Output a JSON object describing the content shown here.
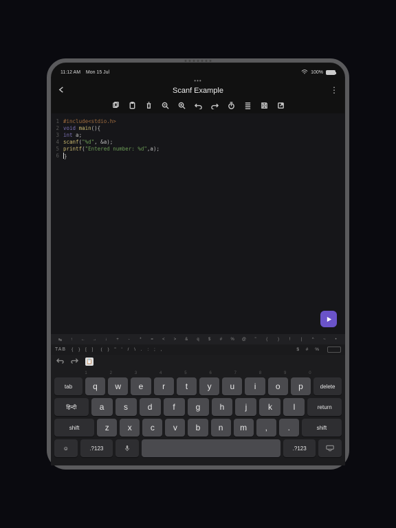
{
  "status": {
    "time": "11:12 AM",
    "date": "Mon 15 Jul",
    "battery": "100%"
  },
  "header": {
    "dots": "•••",
    "title": "Scanf Example"
  },
  "toolbar": {
    "icons": [
      "copy",
      "paste",
      "delete",
      "zoom-out",
      "zoom-in",
      "undo",
      "redo",
      "timer",
      "indent",
      "save",
      "share"
    ]
  },
  "code": {
    "lines": [
      {
        "n": "1",
        "segs": [
          {
            "cls": "tok-preproc",
            "t": "#include<stdio.h>"
          }
        ]
      },
      {
        "n": "2",
        "segs": [
          {
            "cls": "tok-kw",
            "t": "void"
          },
          {
            "cls": "tok-plain",
            "t": " "
          },
          {
            "cls": "tok-fn",
            "t": "main"
          },
          {
            "cls": "tok-plain",
            "t": "(){"
          }
        ]
      },
      {
        "n": "3",
        "segs": [
          {
            "cls": "tok-type",
            "t": "int"
          },
          {
            "cls": "tok-plain",
            "t": " a;"
          }
        ]
      },
      {
        "n": "4",
        "segs": [
          {
            "cls": "tok-fn",
            "t": "scanf"
          },
          {
            "cls": "tok-plain",
            "t": "("
          },
          {
            "cls": "tok-str",
            "t": "\"%d\""
          },
          {
            "cls": "tok-plain",
            "t": ", &a);"
          }
        ]
      },
      {
        "n": "5",
        "segs": [
          {
            "cls": "tok-fn",
            "t": "printf"
          },
          {
            "cls": "tok-plain",
            "t": "("
          },
          {
            "cls": "tok-str",
            "t": "\"Entered number: %d\""
          },
          {
            "cls": "tok-plain",
            "t": ",a);"
          }
        ]
      },
      {
        "n": "6",
        "segs": [
          {
            "cls": "tok-plain",
            "t": "}"
          }
        ],
        "cursor": true
      }
    ]
  },
  "extraRow": [
    "↹",
    "↑",
    "←",
    "→",
    "↓",
    "+",
    "-",
    "*",
    "=",
    "<",
    ">",
    "&",
    "q",
    "$",
    "#",
    "%",
    "@",
    "\"",
    "(",
    ")",
    "!",
    "|",
    "^",
    "~",
    "•"
  ],
  "tabRow": {
    "tab": "TAB",
    "left": "{  }  [  ]",
    "mid": "(  )  \"  '  /  \\  .  :  ;  ,",
    "right": "$  #  %"
  },
  "keyboard": {
    "hints": [
      "1",
      "2",
      "3",
      "4",
      "5",
      "6",
      "7",
      "8",
      "9",
      "0"
    ],
    "row1": [
      "q",
      "w",
      "e",
      "r",
      "t",
      "y",
      "u",
      "i",
      "o",
      "p"
    ],
    "row2": [
      "a",
      "s",
      "d",
      "f",
      "g",
      "h",
      "j",
      "k",
      "l"
    ],
    "row3": [
      "z",
      "x",
      "c",
      "v",
      "b",
      "n",
      "m",
      ",",
      "."
    ],
    "tab": "tab",
    "delete": "delete",
    "lang": "हिन्दी",
    "return": "return",
    "shift": "shift",
    "numkey": ".?123"
  }
}
